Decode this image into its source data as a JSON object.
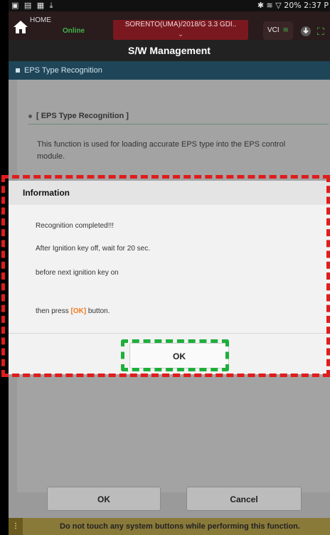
{
  "status_bar": {
    "left_icons": "▣ ▤ ▦ ⤓",
    "right_icons": "✱ ≋ ▽ 20%",
    "time": "2:37 P"
  },
  "header": {
    "home_label": "HOME",
    "online": "Online",
    "vehicle": "SORENTO(UMA)/2018/G 3.3 GDI..",
    "vehicle_chevron": "⌄",
    "vci_label": "VCI"
  },
  "page_title": "S/W Management",
  "section_title": "EPS Type Recognition",
  "function": {
    "title": "[ EPS Type Recognition ]",
    "description": "This function is used for loading accurate EPS type into the EPS control module."
  },
  "dialog": {
    "title": "Information",
    "lines": [
      "Recognition completed!!!",
      "After Ignition key off, wait for 20 sec.",
      "before next ignition key on"
    ],
    "last_line_prefix": "then press ",
    "last_line_highlight": "[OK]",
    "last_line_suffix": " button.",
    "ok_label": "OK"
  },
  "bottom_buttons": {
    "ok": "OK",
    "cancel": "Cancel"
  },
  "warning": "Do not touch any system buttons while performing this function.",
  "colors": {
    "accent_red": "#e01c1c",
    "accent_green": "#1fae3c",
    "highlight_orange": "#f07a20",
    "online_green": "#41b34a"
  }
}
